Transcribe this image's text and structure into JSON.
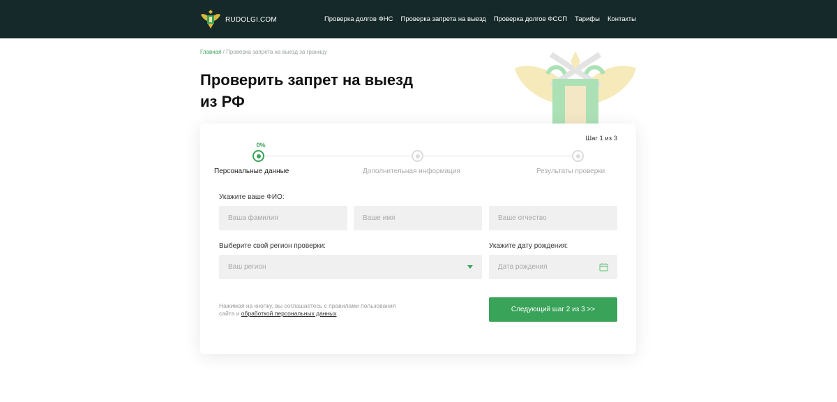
{
  "header": {
    "logo_text": "RUDOLGI.COM",
    "nav": [
      {
        "label": "Проверка долгов ФНС"
      },
      {
        "label": "Проверка запрета на выезд"
      },
      {
        "label": "Проверка долгов ФССП"
      },
      {
        "label": "Тарифы"
      },
      {
        "label": "Контакты"
      }
    ]
  },
  "breadcrumb": {
    "home": "Главная",
    "separator": " / ",
    "current": "Проверка запрета на выезд за границу"
  },
  "page_title_line1": "Проверить запрет на выезд",
  "page_title_line2": "из РФ",
  "wizard": {
    "step_counter": "Шаг 1 из 3",
    "progress_text": "0%",
    "steps": [
      {
        "label": "Персональные данные"
      },
      {
        "label": "Дополнительная информация"
      },
      {
        "label": "Результаты проверки"
      }
    ]
  },
  "form": {
    "fio_label": "Укажите ваше ФИО:",
    "surname_placeholder": "Ваша фамилия",
    "name_placeholder": "Ваше имя",
    "patronymic_placeholder": "Ваше отчество",
    "region_label": "Выберите свой регион проверки:",
    "region_placeholder": "Ваш регион",
    "birthdate_label": "Укажите дату рождения:",
    "birthdate_placeholder": "Дата рождения",
    "consent_text": "Нажимая на кнопку, вы соглашаетесь с правилами пользования сайта и",
    "consent_link": "обработкой персональных данных",
    "submit_label": "Следующий шаг 2 из 3 >>"
  },
  "colors": {
    "header_bg": "#16292a",
    "accent": "#3aa35a",
    "field_bg": "#f0f0f0"
  }
}
